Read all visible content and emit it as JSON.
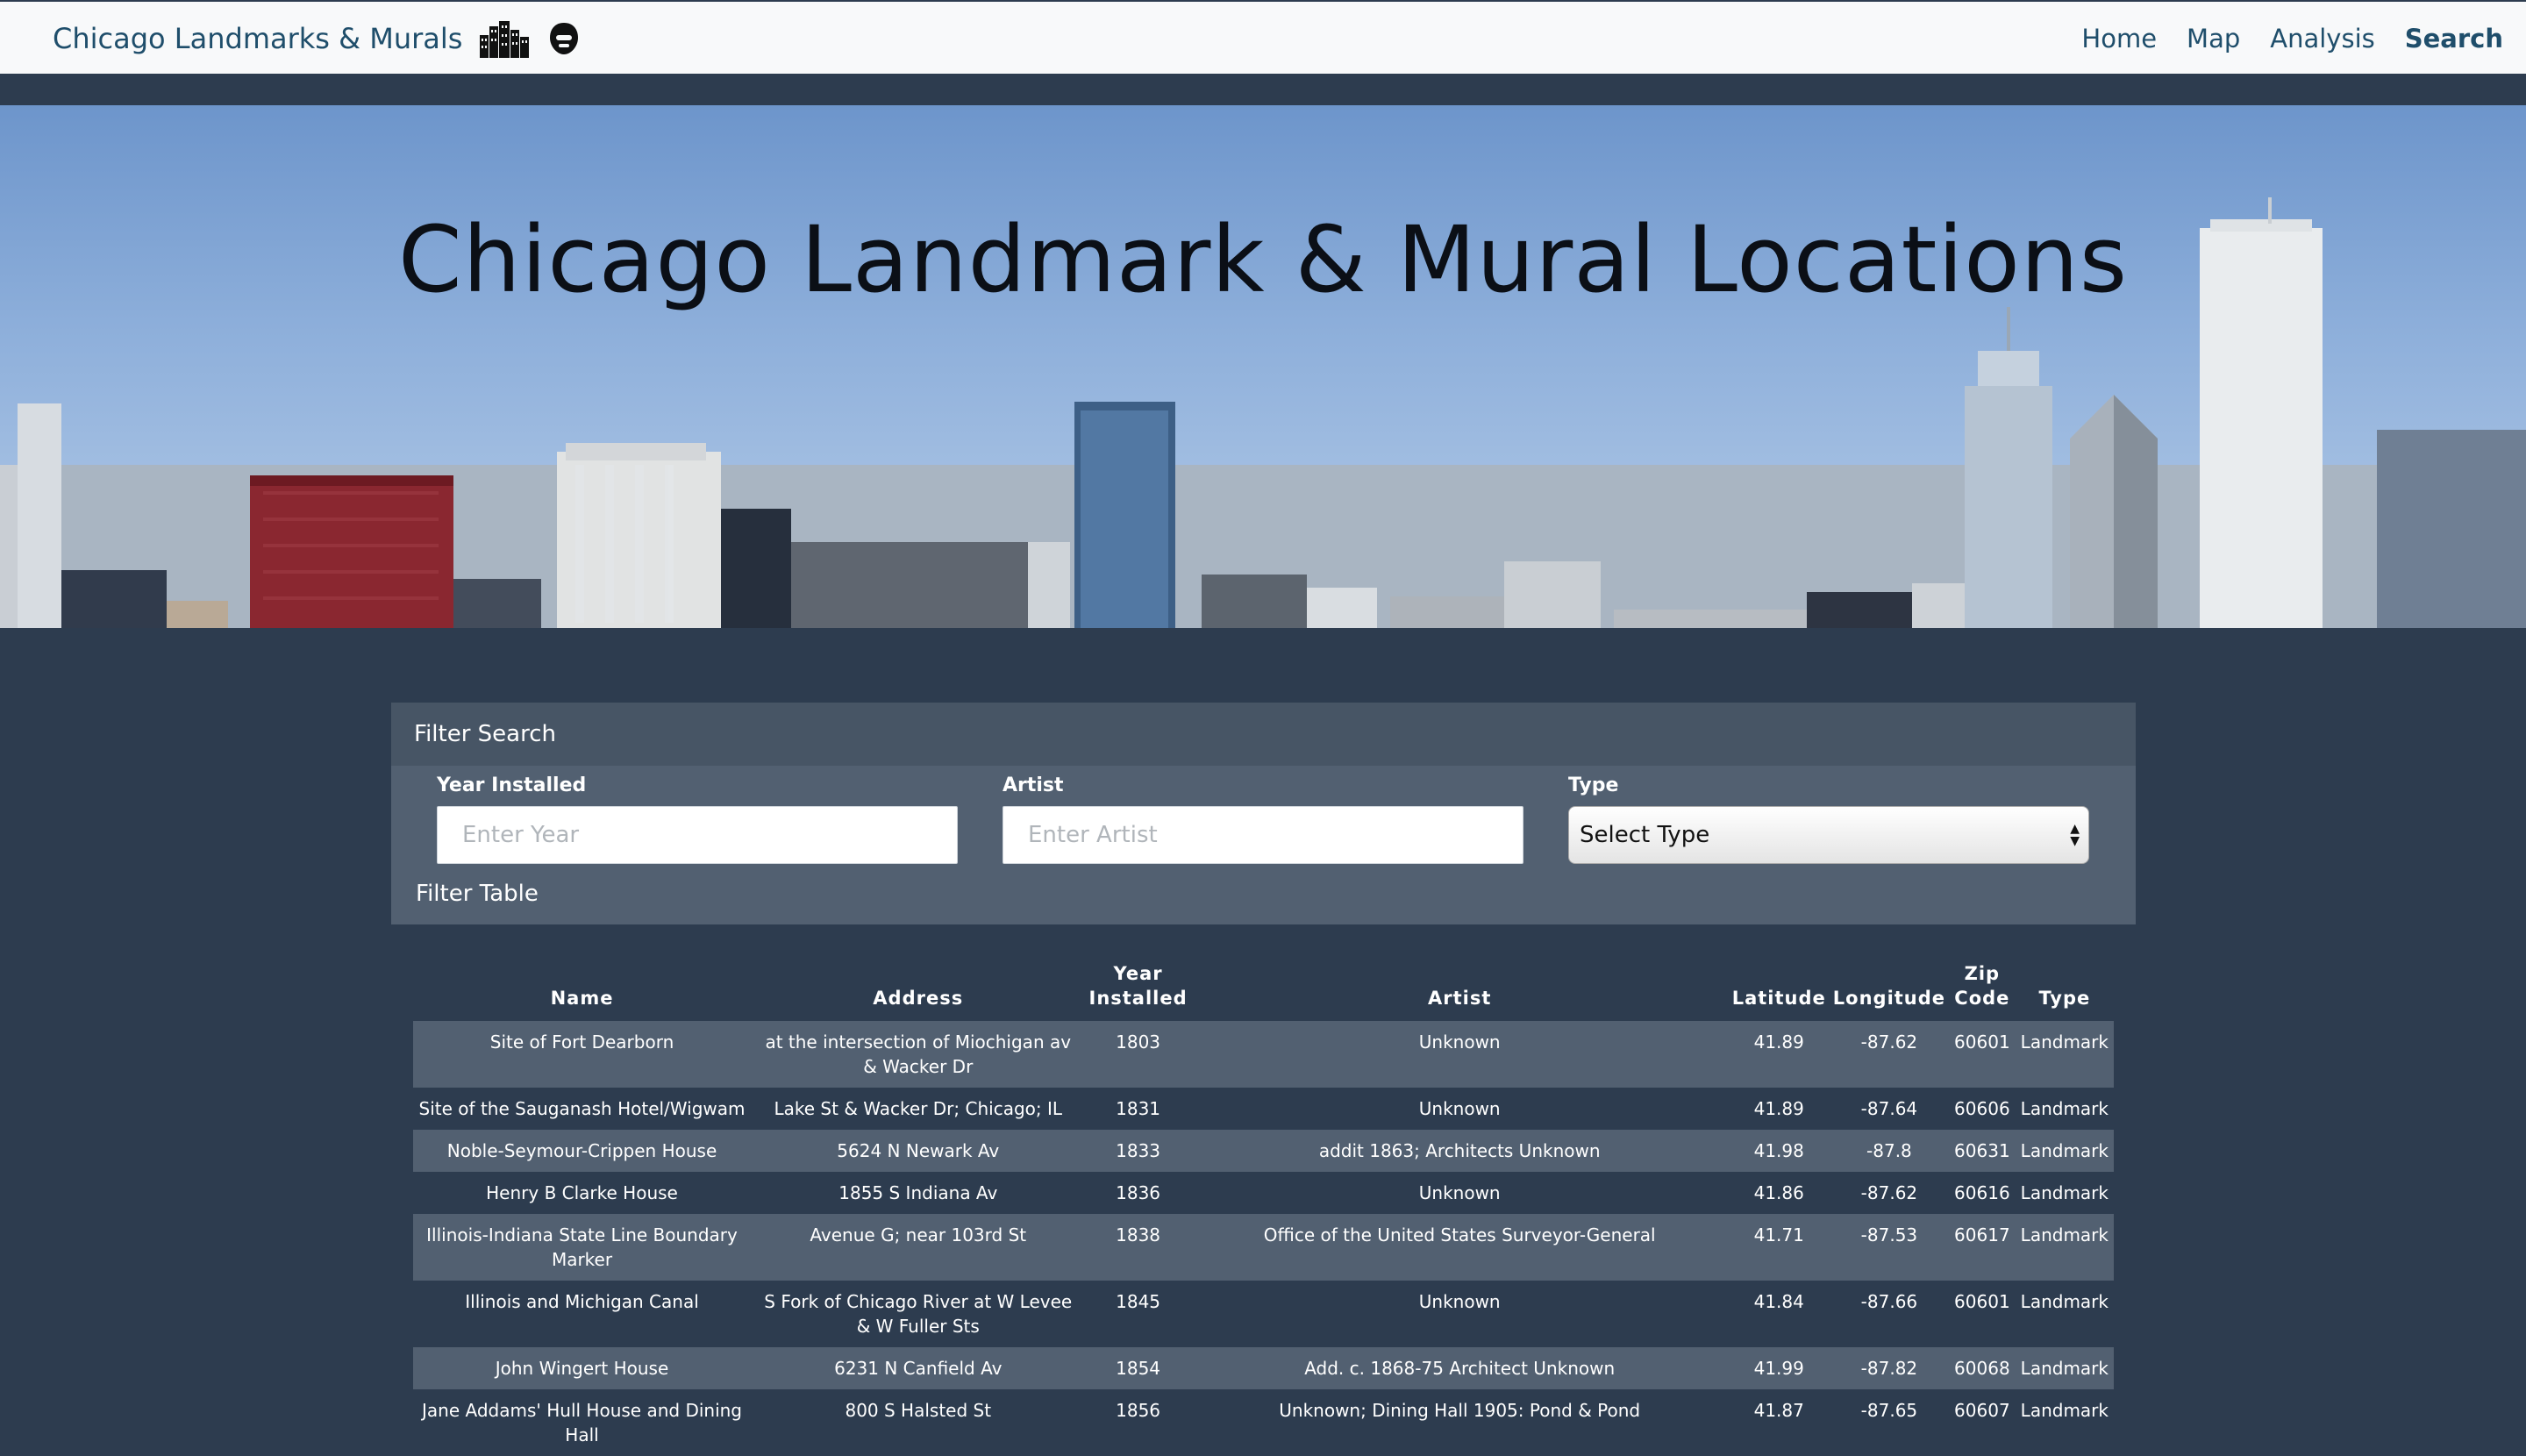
{
  "navbar": {
    "brand": "Chicago Landmarks & Murals",
    "links": [
      "Home",
      "Map",
      "Analysis",
      "Search"
    ],
    "active": "Search"
  },
  "hero": {
    "title": "Chicago Landmark & Mural Locations"
  },
  "filters": {
    "title": "Filter Search",
    "year": {
      "label": "Year Installed",
      "placeholder": "Enter Year"
    },
    "artist": {
      "label": "Artist",
      "placeholder": "Enter Artist"
    },
    "type": {
      "label": "Type",
      "selected": "Select Type"
    },
    "table_button": "Filter Table"
  },
  "table": {
    "headers": {
      "name": "Name",
      "address": "Address",
      "year_1": "Year",
      "year_2": "Installed",
      "artist": "Artist",
      "latitude": "Latitude",
      "longitude": "Longitude",
      "zip_1": "Zip",
      "zip_2": "Code",
      "type": "Type"
    },
    "rows": [
      [
        "Site of Fort Dearborn",
        "at the intersection of Miochigan av & Wacker Dr",
        "1803",
        "Unknown",
        "41.89",
        "-87.62",
        "60601",
        "Landmark"
      ],
      [
        "Site of the Sauganash Hotel/Wigwam",
        "Lake St & Wacker Dr; Chicago; IL",
        "1831",
        "Unknown",
        "41.89",
        "-87.64",
        "60606",
        "Landmark"
      ],
      [
        "Noble-Seymour-Crippen House",
        "5624 N Newark Av",
        "1833",
        "addit 1863; Architects Unknown",
        "41.98",
        "-87.8",
        "60631",
        "Landmark"
      ],
      [
        "Henry B Clarke House",
        "1855 S Indiana Av",
        "1836",
        "Unknown",
        "41.86",
        "-87.62",
        "60616",
        "Landmark"
      ],
      [
        "Illinois-Indiana State Line Boundary Marker",
        "Avenue G; near 103rd St",
        "1838",
        "Office of the United States Surveyor-General",
        "41.71",
        "-87.53",
        "60617",
        "Landmark"
      ],
      [
        "Illinois and Michigan Canal",
        "S Fork of Chicago River at W Levee & W Fuller Sts",
        "1845",
        "Unknown",
        "41.84",
        "-87.66",
        "60601",
        "Landmark"
      ],
      [
        "John Wingert House",
        "6231 N Canfield Av",
        "1854",
        "Add. c. 1868-75 Architect Unknown",
        "41.99",
        "-87.82",
        "60068",
        "Landmark"
      ],
      [
        "Jane Addams' Hull House and Dining Hall",
        "800 S Halsted St",
        "1856",
        "Unknown; Dining Hall 1905: Pond & Pond",
        "41.87",
        "-87.65",
        "60607",
        "Landmark"
      ]
    ]
  }
}
